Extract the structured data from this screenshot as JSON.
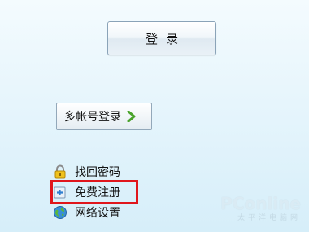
{
  "login_button": {
    "label": "登录"
  },
  "multi_account_button": {
    "label": "多帐号登录"
  },
  "links": [
    {
      "label": "找回密码",
      "icon": "lock-icon"
    },
    {
      "label": "免费注册",
      "icon": "add-user-icon"
    },
    {
      "label": "网络设置",
      "icon": "globe-icon"
    }
  ],
  "watermark": {
    "brand": "PConline",
    "tagline": "太平洋电脑网"
  },
  "colors": {
    "highlight": "#e0161c",
    "chevron": "#4aa32c"
  }
}
